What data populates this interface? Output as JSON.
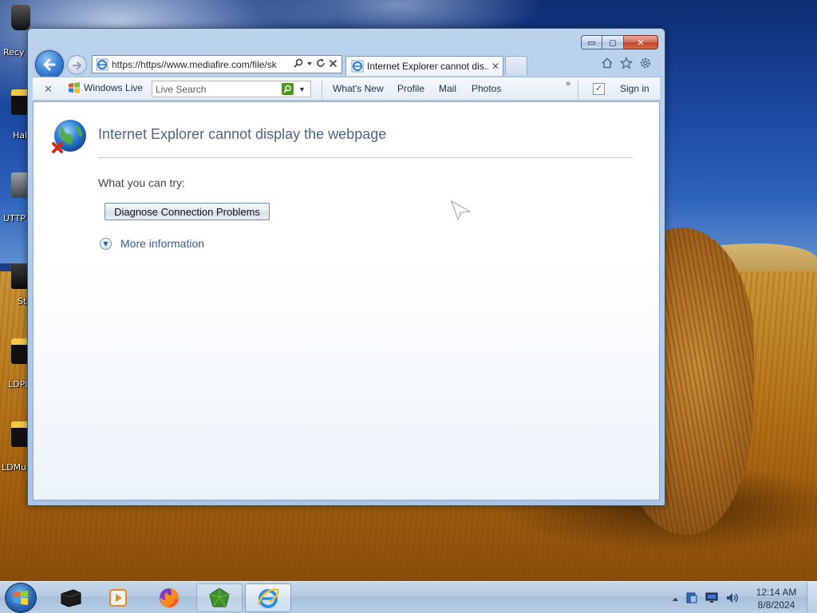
{
  "desktop": {
    "icons": [
      {
        "label": "Recy"
      },
      {
        "label": "Hal"
      },
      {
        "label": "UTTP"
      },
      {
        "label": "St"
      },
      {
        "label": "LDPl"
      },
      {
        "label": "LDMu"
      }
    ]
  },
  "browser": {
    "address": "https://https//www.mediafire.com/file/sk",
    "tab_title": "Internet Explorer cannot dis...",
    "title_controls": {
      "minimize": "▭",
      "maximize": "◻",
      "close": "✕"
    }
  },
  "live_toolbar": {
    "brand": "Windows Live",
    "search_placeholder": "Live Search",
    "links": [
      "What's New",
      "Profile",
      "Mail",
      "Photos"
    ],
    "chevron": "»",
    "sign_in": "Sign in"
  },
  "page": {
    "title": "Internet Explorer cannot display the webpage",
    "try_label": "What you can try:",
    "diagnose_button": "Diagnose Connection Problems",
    "more_info": "More information"
  },
  "taskbar": {
    "time": "12:14 AM",
    "date": "8/8/2024"
  },
  "colors": {
    "link": "#2e5d99",
    "title": "#4e6583",
    "brand_green": "#4a9a22"
  }
}
